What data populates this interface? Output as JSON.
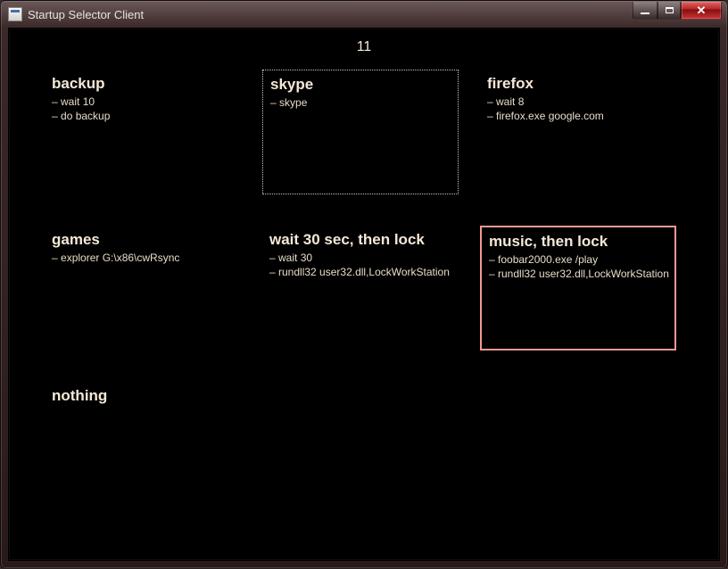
{
  "window": {
    "title": "Startup Selector Client"
  },
  "countdown": "11",
  "tiles": [
    {
      "title": "backup",
      "commands": [
        "wait 10",
        "do backup"
      ],
      "state": "none"
    },
    {
      "title": "skype",
      "commands": [
        "skype"
      ],
      "state": "focused"
    },
    {
      "title": "firefox",
      "commands": [
        "wait 8",
        "firefox.exe google.com"
      ],
      "state": "none"
    },
    {
      "title": "games",
      "commands": [
        "explorer G:\\x86\\cwRsync"
      ],
      "state": "none"
    },
    {
      "title": "wait 30 sec, then lock",
      "commands": [
        "wait 30",
        "rundll32 user32.dll,LockWorkStation"
      ],
      "state": "none"
    },
    {
      "title": "music, then lock",
      "commands": [
        "foobar2000.exe /play",
        "rundll32 user32.dll,LockWorkStation"
      ],
      "state": "selected"
    },
    {
      "title": "nothing",
      "commands": [],
      "state": "none"
    }
  ],
  "bullet": "– "
}
